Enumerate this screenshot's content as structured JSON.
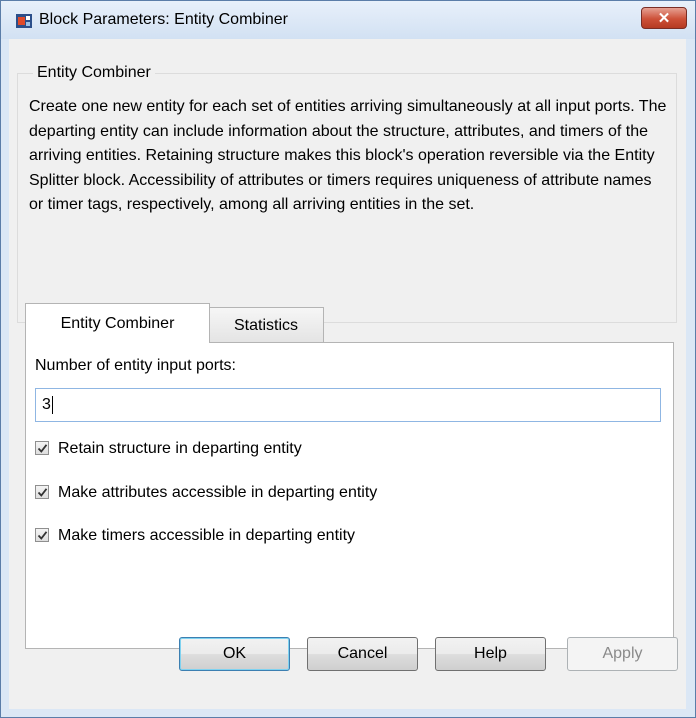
{
  "window": {
    "title": "Block Parameters: Entity Combiner",
    "close_label": "✕"
  },
  "groupbox": {
    "title": "Entity Combiner",
    "description": "Create one new entity for each set of entities arriving simultaneously at all input ports. The departing entity can include information about the structure, attributes, and timers of the arriving entities. Retaining structure makes this block's operation reversible via the Entity Splitter block. Accessibility of attributes or timers requires uniqueness of attribute names or timer tags, respectively, among all arriving entities in the set."
  },
  "tabs": [
    {
      "label": "Entity Combiner",
      "active": true
    },
    {
      "label": "Statistics",
      "active": false
    }
  ],
  "form": {
    "ports_label": "Number of entity input ports:",
    "ports_value": "3",
    "checkboxes": [
      {
        "label": "Retain structure in departing entity",
        "checked": true
      },
      {
        "label": "Make attributes accessible in departing entity",
        "checked": true
      },
      {
        "label": "Make timers accessible in departing entity",
        "checked": true
      }
    ]
  },
  "buttons": {
    "ok": "OK",
    "cancel": "Cancel",
    "help": "Help",
    "apply": "Apply"
  },
  "icons": {
    "app": "block-diagram-icon",
    "close": "close-icon",
    "check": "check-icon"
  },
  "colors": {
    "title_bar": "#d2e1f3",
    "close_button": "#cd5038",
    "input_border": "#8fb6e3"
  }
}
